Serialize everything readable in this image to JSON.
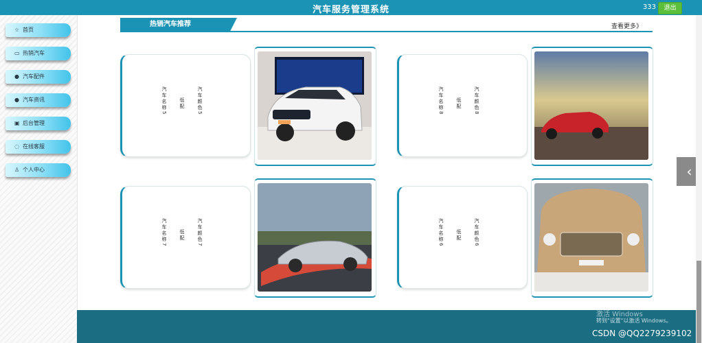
{
  "header": {
    "title": "汽车服务管理系统",
    "username": "333",
    "logout_label": "退出"
  },
  "sidebar": {
    "items": [
      {
        "label": "首页",
        "icon": "home-icon"
      },
      {
        "label": "热销汽车",
        "icon": "car-icon"
      },
      {
        "label": "汽车配件",
        "icon": "parts-icon"
      },
      {
        "label": "汽车资讯",
        "icon": "news-icon"
      },
      {
        "label": "后台管理",
        "icon": "admin-icon"
      },
      {
        "label": "在线客服",
        "icon": "service-icon"
      },
      {
        "label": "个人中心",
        "icon": "user-icon"
      }
    ]
  },
  "section": {
    "title": "热销汽车推荐",
    "more_label": "查看更多》"
  },
  "cars": [
    {
      "name": "汽车名称5",
      "config": "低配",
      "color": "汽车颜色5"
    },
    {
      "name": "汽车名称8",
      "config": "低配",
      "color": "汽车颜色8"
    },
    {
      "name": "汽车名称7",
      "config": "低配",
      "color": "汽车颜色7"
    },
    {
      "name": "汽车名称6",
      "config": "低配",
      "color": "汽车颜色6"
    }
  ],
  "overlay": {
    "windows_line1": "激活 Windows",
    "windows_line2": "转到\"设置\"以激活 Windows。",
    "watermark": "CSDN @QQ2279239102"
  },
  "colors": {
    "primary": "#1b93b4",
    "footer": "#1b6e82",
    "logout": "#5cbf3b"
  }
}
